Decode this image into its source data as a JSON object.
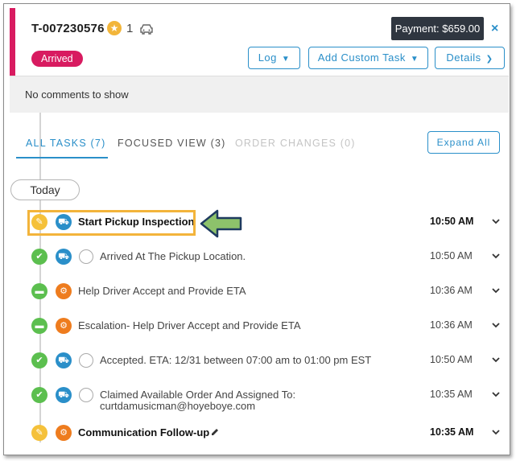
{
  "header": {
    "ticket_id": "T-007230576",
    "star_count": "1",
    "payment": "Payment: $659.00",
    "close": "×",
    "status": "Arrived",
    "buttons": {
      "log": "Log",
      "add_task": "Add Custom Task",
      "details": "Details"
    }
  },
  "comments": {
    "empty_text": "No comments to show"
  },
  "tabs": [
    {
      "label": "ALL TASKS (7)"
    },
    {
      "label": "FOCUSED VIEW (3)"
    },
    {
      "label": "ORDER CHANGES (0)"
    }
  ],
  "expand_all": "Expand All",
  "day_label": "Today",
  "tasks": [
    {
      "title": "Start Pickup Inspection",
      "time": "10:50 AM",
      "status": "in-progress",
      "category": "truck",
      "bold": true
    },
    {
      "title": "Arrived At The Pickup Location.",
      "time": "10:50 AM",
      "status": "done",
      "category": "truck",
      "avatar": true
    },
    {
      "title": "Help Driver Accept and Provide ETA",
      "time": "10:36 AM",
      "status": "deleted",
      "category": "gear"
    },
    {
      "title": "Escalation- Help Driver Accept and Provide ETA",
      "time": "10:36 AM",
      "status": "deleted",
      "category": "gear"
    },
    {
      "title": "Accepted. ETA: 12/31 between 07:00 am to 01:00 pm EST",
      "time": "10:50 AM",
      "status": "done",
      "category": "truck",
      "avatar": true
    },
    {
      "title_line1": "Claimed Available Order And Assigned To:",
      "title_line2": "curtdamusicman@hoyeboye.com",
      "time": "10:35 AM",
      "status": "done",
      "category": "truck",
      "avatar": true
    },
    {
      "title": "Communication Follow-up",
      "time": "10:35 AM",
      "status": "in-progress",
      "category": "gear",
      "bold": true
    }
  ],
  "colors": {
    "accent": "#d81b60",
    "primary": "#2a8fc9",
    "success": "#5cbf4f",
    "warning": "#f5c13a",
    "orange": "#ee7c1e",
    "highlight": "#f3b43b",
    "arrow": "#8dc26b"
  }
}
